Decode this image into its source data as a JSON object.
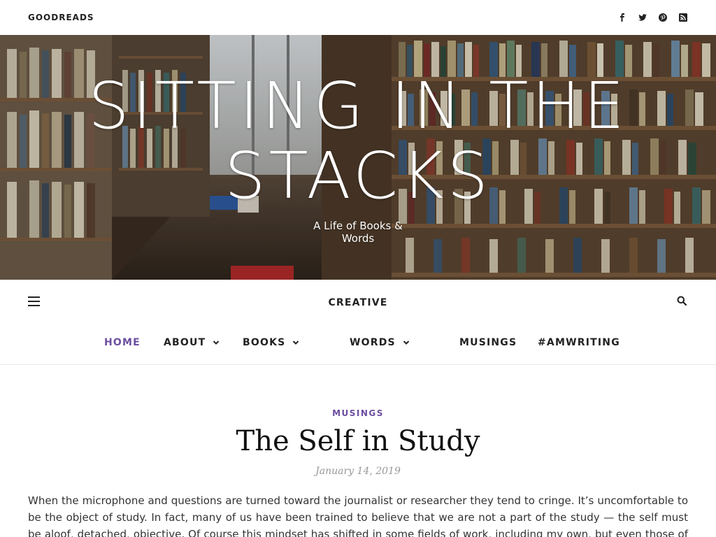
{
  "topbar": {
    "link": "GOODREADS",
    "social": [
      "facebook-icon",
      "twitter-icon",
      "pinterest-icon",
      "rss-icon"
    ]
  },
  "hero": {
    "title": "SITTING IN THE STACKS",
    "tagline": "A Life of Books & Words"
  },
  "nav": {
    "creative": "CREATIVE",
    "items": [
      {
        "label": "HOME",
        "active": true
      },
      {
        "label": "ABOUT",
        "dropdown": true
      },
      {
        "label": "BOOKS",
        "dropdown": true
      },
      {
        "label": "WORDS",
        "dropdown": true
      },
      {
        "label": "MUSINGS"
      },
      {
        "label": "#AMWRITING"
      }
    ]
  },
  "post": {
    "category": "MUSINGS",
    "title": "The Self in Study",
    "date": "January 14, 2019",
    "body": "When the microphone and questions are turned toward the journalist or researcher they tend to cringe. It’s uncomfortable to be the object of study. In fact, many of us have been trained to believe that we are not a part of the study — the self must be aloof, detached, objective. Of course this mindset has shifted in some fields of work, including my own, but even those of us who champion self-"
  },
  "colors": {
    "accent": "#6b4ea0",
    "text": "#222222",
    "muted": "#999999"
  }
}
